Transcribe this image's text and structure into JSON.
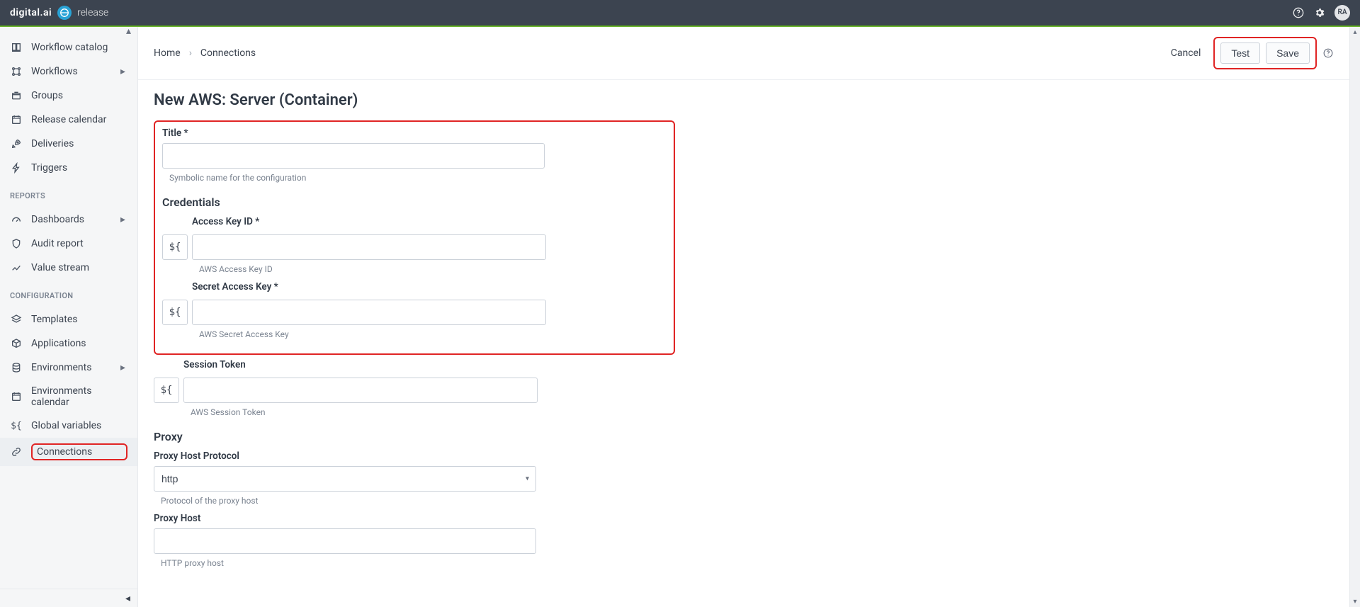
{
  "brand": {
    "logo": "digital.ai",
    "product": "release"
  },
  "avatar": "RA",
  "sidebar": {
    "items1": [
      {
        "label": "Workflow catalog"
      },
      {
        "label": "Workflows"
      },
      {
        "label": "Groups"
      },
      {
        "label": "Release calendar"
      },
      {
        "label": "Deliveries"
      },
      {
        "label": "Triggers"
      }
    ],
    "section_reports": "REPORTS",
    "items2": [
      {
        "label": "Dashboards"
      },
      {
        "label": "Audit report"
      },
      {
        "label": "Value stream"
      }
    ],
    "section_config": "CONFIGURATION",
    "items3": [
      {
        "label": "Templates"
      },
      {
        "label": "Applications"
      },
      {
        "label": "Environments"
      },
      {
        "label": "Environments calendar"
      },
      {
        "label": "Global variables"
      },
      {
        "label": "Connections"
      }
    ]
  },
  "breadcrumbs": {
    "home": "Home",
    "current": "Connections"
  },
  "actions": {
    "cancel": "Cancel",
    "test": "Test",
    "save": "Save"
  },
  "page": {
    "title": "New AWS: Server (Container)",
    "sections": {
      "credentials": "Credentials",
      "proxy": "Proxy"
    },
    "fields": {
      "title": {
        "label": "Title *",
        "value": "",
        "help": "Symbolic name for the configuration"
      },
      "accessKey": {
        "label": "Access Key ID *",
        "value": "",
        "help": "AWS Access Key ID"
      },
      "secretKey": {
        "label": "Secret Access Key *",
        "value": "",
        "help": "AWS Secret Access Key"
      },
      "sessionToken": {
        "label": "Session Token",
        "value": "",
        "help": "AWS Session Token"
      },
      "proxyProtocol": {
        "label": "Proxy Host Protocol",
        "value": "http",
        "help": "Protocol of the proxy host"
      },
      "proxyHost": {
        "label": "Proxy Host",
        "value": "",
        "help": "HTTP proxy host"
      }
    },
    "variablePrefix": "${"
  }
}
